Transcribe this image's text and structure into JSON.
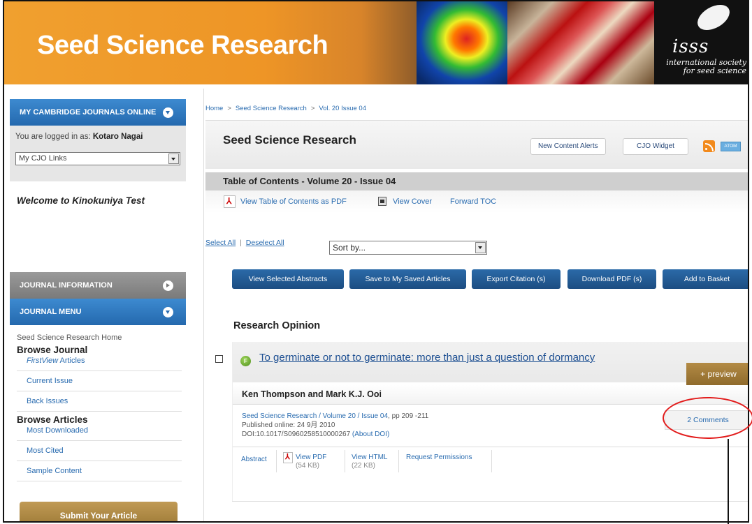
{
  "banner": {
    "title": "Seed Science Research",
    "logo_text": "isss",
    "logo_subtitle": "international society for seed science"
  },
  "sidebar": {
    "my_cjo_header": "MY CAMBRIDGE JOURNALS ONLINE",
    "logged_in_prefix": "You are logged in as:",
    "logged_in_user": "Kotaro Nagai",
    "links_select": "My CJO Links",
    "welcome": "Welcome to Kinokuniya Test",
    "journal_info_header": "JOURNAL INFORMATION",
    "journal_menu_header": "JOURNAL MENU",
    "home_link": "Seed Science Research Home",
    "browse_journal": "Browse Journal",
    "firstview_italic": "FirstView",
    "firstview_rest": " Articles",
    "current_issue": "Current Issue",
    "back_issues": "Back Issues",
    "browse_articles": "Browse Articles",
    "most_downloaded": "Most Downloaded",
    "most_cited": "Most Cited",
    "sample_content": "Sample Content",
    "submit_article": "Submit Your Article"
  },
  "breadcrumb": {
    "home": "Home",
    "journal": "Seed Science Research",
    "issue": "Vol. 20 Issue 04",
    "separator": ">"
  },
  "journal_bar": {
    "title": "Seed Science Research",
    "new_content_alerts": "New Content Alerts",
    "cjo_widget": "CJO Widget",
    "atom": "ATOM"
  },
  "toc": {
    "heading": "Table of Contents - Volume 20 - Issue 04",
    "view_pdf": "View Table of Contents as PDF",
    "view_cover": "View Cover",
    "forward_toc": "Forward TOC"
  },
  "controls": {
    "select_all": "Select All",
    "deselect_all": "Deselect All",
    "sort_by": "Sort by...",
    "buttons": [
      "View Selected Abstracts",
      "Save to My Saved Articles",
      "Export Citation (s)",
      "Download PDF (s)",
      "Add to Basket"
    ]
  },
  "section": {
    "title": "Research Opinion"
  },
  "article": {
    "free_badge": "F",
    "title": "To germinate or not to germinate: more than just a question of dormancy",
    "preview": "+ preview",
    "authors": "Ken Thompson and Mark K.J. Ooi",
    "citation_link": "Seed Science Research / Volume 20 / Issue 04",
    "pages": ", pp 209 -211",
    "published": "Published online: 24 9月 2010",
    "doi": "DOI:10.1017/S0960258510000267",
    "about_doi": "(About DOI)",
    "comments": "2 Comments",
    "actions": {
      "abstract": "Abstract",
      "view_pdf": "View PDF",
      "pdf_size": "(54 KB)",
      "view_html": "View HTML",
      "html_size": "(22 KB)",
      "request_permissions": "Request Permissions"
    }
  }
}
